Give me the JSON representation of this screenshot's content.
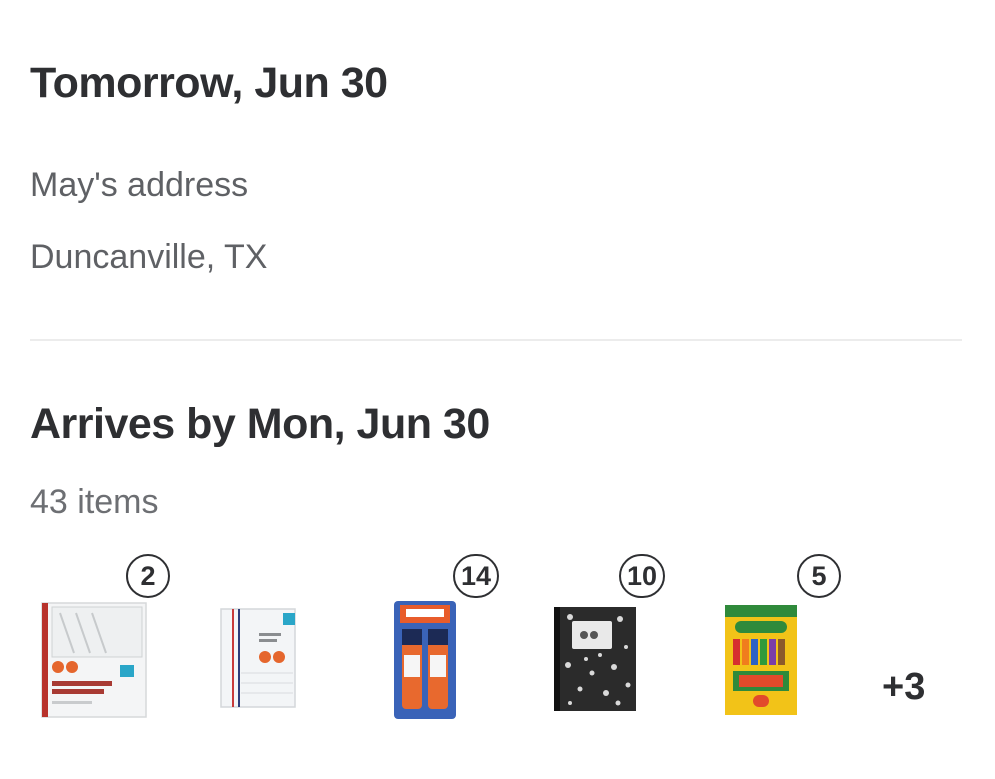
{
  "pickup": {
    "title": "Tomorrow, Jun 30",
    "address_name": "May's address",
    "address_city": "Duncanville, TX"
  },
  "delivery": {
    "title": "Arrives by Mon, Jun 30",
    "items_count": "43 items",
    "items": [
      {
        "name": "sheet-protectors",
        "icon": "sheet-protectors-icon",
        "quantity": "2"
      },
      {
        "name": "filler-paper",
        "icon": "filler-paper-icon",
        "quantity": ""
      },
      {
        "name": "glue-sticks",
        "icon": "glue-sticks-icon",
        "quantity": "14"
      },
      {
        "name": "composition-notebook",
        "icon": "composition-notebook-icon",
        "quantity": "10"
      },
      {
        "name": "crayons",
        "icon": "crayons-icon",
        "quantity": "5"
      }
    ],
    "more_count": "+3"
  },
  "colors": {
    "text_primary": "#2e2f32",
    "text_secondary": "#5f6165",
    "divider": "#ececec"
  }
}
